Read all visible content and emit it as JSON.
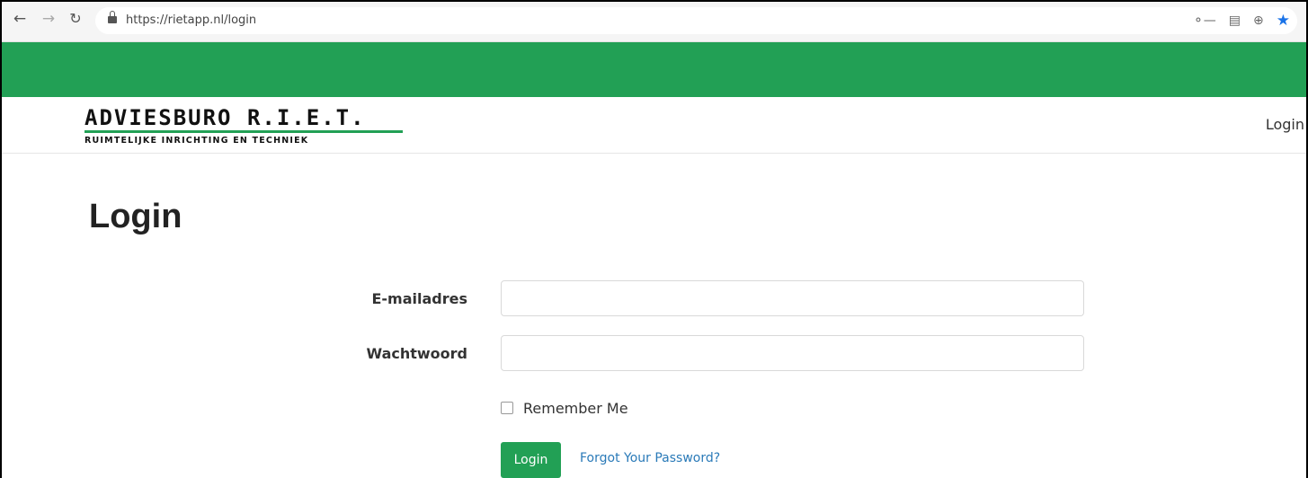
{
  "browser": {
    "url": "https://rietapp.nl/login",
    "back_icon": "arrow-left",
    "forward_icon": "arrow-right",
    "reload_icon": "reload",
    "omni_icons": [
      "key-icon",
      "translate-icon",
      "zoom-icon",
      "star-icon"
    ]
  },
  "header": {
    "accent_color": "#22a055",
    "logo": {
      "title": "ADVIESBURO R.I.E.T.",
      "subtitle": "RUIMTELIJKE INRICHTING EN TECHNIEK"
    },
    "nav_login": "Login"
  },
  "page": {
    "title": "Login"
  },
  "form": {
    "email_label": "E-mailadres",
    "email_value": "",
    "password_label": "Wachtwoord",
    "password_value": "",
    "remember_label": "Remember Me",
    "remember_checked": false,
    "submit_label": "Login",
    "forgot_label": "Forgot Your Password?"
  }
}
